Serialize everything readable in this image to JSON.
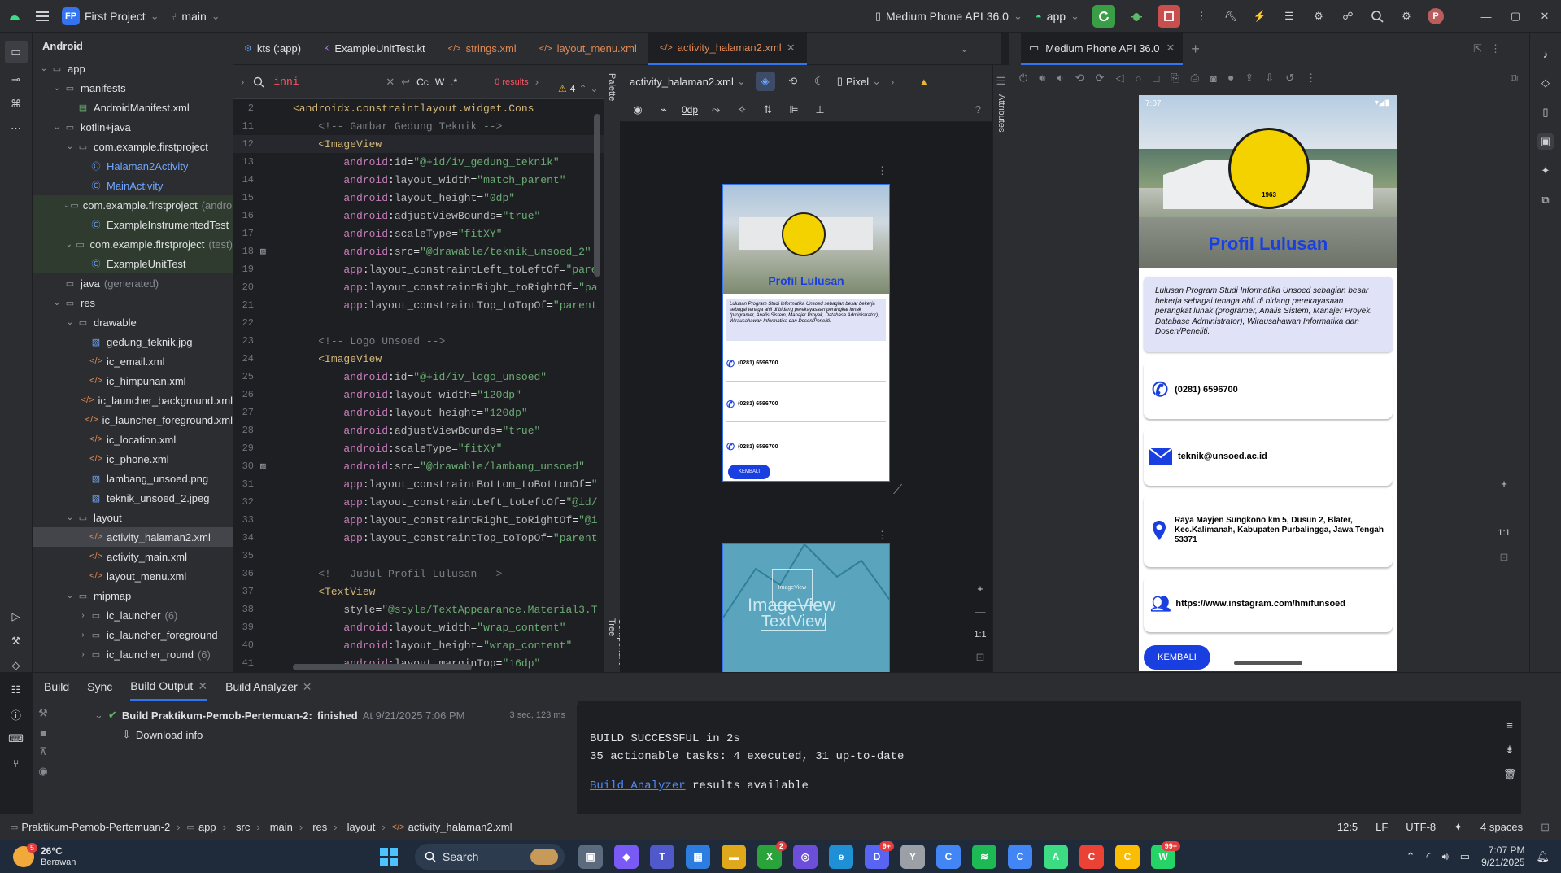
{
  "titlebar": {
    "project_chip": "FP",
    "project": "First Project",
    "branch": "main",
    "device": "Medium Phone API 36.0",
    "run_config": "app",
    "avatar": "P"
  },
  "project_panel": {
    "title": "Android",
    "tree": [
      {
        "label": "app",
        "depth": 0,
        "icon": "folder",
        "open": true
      },
      {
        "label": "manifests",
        "depth": 1,
        "icon": "folder",
        "open": true
      },
      {
        "label": "AndroidManifest.xml",
        "depth": 2,
        "icon": "manifest"
      },
      {
        "label": "kotlin+java",
        "depth": 1,
        "icon": "folder",
        "open": true
      },
      {
        "label": "com.example.firstproject",
        "depth": 2,
        "icon": "package",
        "open": true
      },
      {
        "label": "Halaman2Activity",
        "depth": 3,
        "icon": "class",
        "color": "blue"
      },
      {
        "label": "MainActivity",
        "depth": 3,
        "icon": "class",
        "color": "blue"
      },
      {
        "label": "com.example.firstproject",
        "depth": 2,
        "icon": "package",
        "open": true,
        "suffix": "(androidTest)",
        "hl": true
      },
      {
        "label": "ExampleInstrumentedTest",
        "depth": 3,
        "icon": "class",
        "hl": true
      },
      {
        "label": "com.example.firstproject",
        "depth": 2,
        "icon": "package",
        "open": true,
        "suffix": "(test)",
        "hl": true
      },
      {
        "label": "ExampleUnitTest",
        "depth": 3,
        "icon": "class",
        "hl": true
      },
      {
        "label": "java",
        "depth": 1,
        "icon": "folder",
        "suffix": "(generated)"
      },
      {
        "label": "res",
        "depth": 1,
        "icon": "folder",
        "open": true
      },
      {
        "label": "drawable",
        "depth": 2,
        "icon": "folder",
        "open": true
      },
      {
        "label": "gedung_teknik.jpg",
        "depth": 3,
        "icon": "image"
      },
      {
        "label": "ic_email.xml",
        "depth": 3,
        "icon": "xml"
      },
      {
        "label": "ic_himpunan.xml",
        "depth": 3,
        "icon": "xml"
      },
      {
        "label": "ic_launcher_background.xml",
        "depth": 3,
        "icon": "xml"
      },
      {
        "label": "ic_launcher_foreground.xml",
        "depth": 3,
        "icon": "xml"
      },
      {
        "label": "ic_location.xml",
        "depth": 3,
        "icon": "xml"
      },
      {
        "label": "ic_phone.xml",
        "depth": 3,
        "icon": "xml"
      },
      {
        "label": "lambang_unsoed.png",
        "depth": 3,
        "icon": "image"
      },
      {
        "label": "teknik_unsoed_2.jpeg",
        "depth": 3,
        "icon": "image"
      },
      {
        "label": "layout",
        "depth": 2,
        "icon": "folder",
        "open": true
      },
      {
        "label": "activity_halaman2.xml",
        "depth": 3,
        "icon": "xml",
        "selected": true
      },
      {
        "label": "activity_main.xml",
        "depth": 3,
        "icon": "xml"
      },
      {
        "label": "layout_menu.xml",
        "depth": 3,
        "icon": "xml"
      },
      {
        "label": "mipmap",
        "depth": 2,
        "icon": "folder",
        "open": true
      },
      {
        "label": "ic_launcher",
        "depth": 3,
        "icon": "folder",
        "suffix": "(6)",
        "closed": true
      },
      {
        "label": "ic_launcher_foreground",
        "depth": 3,
        "icon": "folder",
        "closed": true
      },
      {
        "label": "ic_launcher_round",
        "depth": 3,
        "icon": "folder",
        "suffix": "(6)",
        "closed": true
      }
    ]
  },
  "editor_tabs": [
    {
      "label": "kts (:app)",
      "icon": "kts"
    },
    {
      "label": "ExampleUnitTest.kt",
      "icon": "kotlin"
    },
    {
      "label": "strings.xml",
      "icon": "xml"
    },
    {
      "label": "layout_menu.xml",
      "icon": "xml"
    },
    {
      "label": "activity_halaman2.xml",
      "icon": "xml",
      "active": true
    }
  ],
  "find": {
    "query": "inni",
    "results": "0 results",
    "case": "Cc",
    "word": "W",
    "regex": ".*"
  },
  "code": {
    "warnings": "4",
    "lines": [
      {
        "n": "2",
        "html": "<span class='tag'>&lt;androidx.constraintlayout.widget.Cons</span>"
      },
      {
        "n": "11",
        "html": "    <span class='cmt'>&lt;!-- Gambar Gedung Teknik --&gt;</span>"
      },
      {
        "n": "12",
        "html": "    <span class='tag'>&lt;ImageView</span>",
        "cur": true
      },
      {
        "n": "13",
        "html": "        <span class='ns'>android</span>:<span class='attr'>id</span>=<span class='val'>\"@+id/iv_gedung_teknik\"</span>"
      },
      {
        "n": "14",
        "html": "        <span class='ns'>android</span>:<span class='attr'>layout_width</span>=<span class='val'>\"match_parent\"</span>"
      },
      {
        "n": "15",
        "html": "        <span class='ns'>android</span>:<span class='attr'>layout_height</span>=<span class='val'>\"0dp\"</span>"
      },
      {
        "n": "16",
        "html": "        <span class='ns'>android</span>:<span class='attr'>adjustViewBounds</span>=<span class='val'>\"true\"</span>"
      },
      {
        "n": "17",
        "html": "        <span class='ns'>android</span>:<span class='attr'>scaleType</span>=<span class='val'>\"fitXY\"</span>"
      },
      {
        "n": "18",
        "html": "        <span class='ns'>android</span>:<span class='attr'>src</span>=<span class='val'>\"@drawable/teknik_unsoed_2\"</span>",
        "gutter": "img"
      },
      {
        "n": "19",
        "html": "        <span class='ns'>app</span>:<span class='attr'>layout_constraintLeft_toLeftOf</span>=<span class='val'>\"pare</span>"
      },
      {
        "n": "20",
        "html": "        <span class='ns'>app</span>:<span class='attr'>layout_constraintRight_toRightOf</span>=<span class='val'>\"pa</span>"
      },
      {
        "n": "21",
        "html": "        <span class='ns'>app</span>:<span class='attr'>layout_constraintTop_toTopOf</span>=<span class='val'>\"parent</span>"
      },
      {
        "n": "22",
        "html": ""
      },
      {
        "n": "23",
        "html": "    <span class='cmt'>&lt;!-- Logo Unsoed --&gt;</span>"
      },
      {
        "n": "24",
        "html": "    <span class='tag'>&lt;ImageView</span>"
      },
      {
        "n": "25",
        "html": "        <span class='ns'>android</span>:<span class='attr'>id</span>=<span class='val'>\"@+id/iv_logo_unsoed\"</span>"
      },
      {
        "n": "26",
        "html": "        <span class='ns'>android</span>:<span class='attr'>layout_width</span>=<span class='val'>\"120dp\"</span>"
      },
      {
        "n": "27",
        "html": "        <span class='ns'>android</span>:<span class='attr'>layout_height</span>=<span class='val'>\"120dp\"</span>"
      },
      {
        "n": "28",
        "html": "        <span class='ns'>android</span>:<span class='attr'>adjustViewBounds</span>=<span class='val'>\"true\"</span>"
      },
      {
        "n": "29",
        "html": "        <span class='ns'>android</span>:<span class='attr'>scaleType</span>=<span class='val'>\"fitXY\"</span>"
      },
      {
        "n": "30",
        "html": "        <span class='ns'>android</span>:<span class='attr'>src</span>=<span class='val'>\"@drawable/lambang_unsoed\"</span>",
        "gutter": "img"
      },
      {
        "n": "31",
        "html": "        <span class='ns'>app</span>:<span class='attr'>layout_constraintBottom_toBottomOf</span>=<span class='val'>\"</span>"
      },
      {
        "n": "32",
        "html": "        <span class='ns'>app</span>:<span class='attr'>layout_constraintLeft_toLeftOf</span>=<span class='val'>\"@id/</span>"
      },
      {
        "n": "33",
        "html": "        <span class='ns'>app</span>:<span class='attr'>layout_constraintRight_toRightOf</span>=<span class='val'>\"@i</span>"
      },
      {
        "n": "34",
        "html": "        <span class='ns'>app</span>:<span class='attr'>layout_constraintTop_toTopOf</span>=<span class='val'>\"parent</span>"
      },
      {
        "n": "35",
        "html": ""
      },
      {
        "n": "36",
        "html": "    <span class='cmt'>&lt;!-- Judul Profil Lulusan --&gt;</span>"
      },
      {
        "n": "37",
        "html": "    <span class='tag'>&lt;TextView</span>"
      },
      {
        "n": "38",
        "html": "        <span class='attr'>style</span>=<span class='val'>\"@style/TextAppearance.Material3.T</span>"
      },
      {
        "n": "39",
        "html": "        <span class='ns'>android</span>:<span class='attr'>layout_width</span>=<span class='val'>\"wrap_content\"</span>"
      },
      {
        "n": "40",
        "html": "        <span class='ns'>android</span>:<span class='attr'>layout_height</span>=<span class='val'>\"wrap_content\"</span>"
      },
      {
        "n": "41",
        "html": "        <span class='ns'>android</span>:<span class='attr'>layout_marginTop</span>=<span class='val'>\"16dp\"</span>"
      }
    ]
  },
  "design": {
    "file": "activity_halaman2.xml",
    "device": "Pixel",
    "margin": "0dp",
    "palette_label": "Palette",
    "component_tree_label": "Component Tree",
    "attributes_label": "Attributes",
    "preview": {
      "title": "Profil Lulusan",
      "desc": "Lulusan Program Studi Informatika Unsoed sebagian besar bekerja sebagai tenaga ahli di bidang perekayasaan perangkat lunak (programer, Analis Sistem, Manajer Proyek, Database Administrator), Wirausahawan Informatika dan Dosen/Peneliti.",
      "phone": "(0281) 6596700",
      "button": "KEMBALI"
    },
    "blueprint_imageview": "ImageView",
    "blueprint_textview": "TextView",
    "blueprint_small": "ImageView",
    "zoom": "1:1"
  },
  "emulator": {
    "tab": "Medium Phone API 36.0",
    "status_time": "7:07",
    "title": "Profil Lulusan",
    "seal_year": "1963",
    "desc": "Lulusan Program Studi Informatika Unsoed sebagian besar bekerja sebagai tenaga ahli di bidang perekayasaan perangkat lunak (programer, Analis Sistem, Manajer Proyek. Database Administrator), Wirausahawan Informatika dan Dosen/Peneliti.",
    "phone": "(0281) 6596700",
    "email": "teknik@unsoed.ac.id",
    "address": "Raya Mayjen Sungkono km 5, Dusun 2, Blater, Kec.Kalimanah, Kabupaten Purbalingga, Jawa Tengah 53371",
    "instagram": "https://www.instagram.com/hmifunsoed",
    "button": "KEMBALI",
    "accent": "#1a3fe0"
  },
  "bottom": {
    "tabs": [
      "Build",
      "Sync",
      "Build Output",
      "Build Analyzer"
    ],
    "build_title": "Build Praktikum-Pemob-Pertemuan-2:",
    "build_status": "finished",
    "build_time": "At 9/21/2025 7:06 PM",
    "build_duration": "3 sec, 123 ms",
    "download": "Download info",
    "out_line1": "BUILD SUCCESSFUL in 2s",
    "out_line2": "35 actionable tasks: 4 executed, 31 up-to-date",
    "out_link": "Build Analyzer",
    "out_line3": " results available"
  },
  "statusbar": {
    "crumbs": [
      "Praktikum-Pemob-Pertemuan-2",
      "app",
      "src",
      "main",
      "res",
      "layout",
      "activity_halaman2.xml"
    ],
    "pos": "12:5",
    "lf": "LF",
    "enc": "UTF-8",
    "indent": "4 spaces"
  },
  "taskbar": {
    "temp": "26°C",
    "weather": "Berawan",
    "weather_badge": "5",
    "search": "Search",
    "time": "7:07 PM",
    "date": "9/21/2025",
    "apps": [
      {
        "name": "task-view",
        "color": "#5b6a7d",
        "glyph": "▣"
      },
      {
        "name": "copilot",
        "color": "#7a5af5",
        "glyph": "◆"
      },
      {
        "name": "teams",
        "color": "#5059c9",
        "glyph": "T"
      },
      {
        "name": "store",
        "color": "#2d7de0",
        "glyph": "▦"
      },
      {
        "name": "file-explorer",
        "color": "#e0a81b",
        "glyph": "▬"
      },
      {
        "name": "xbox",
        "color": "#2aa33a",
        "glyph": "X",
        "badge": "2"
      },
      {
        "name": "camera-app",
        "color": "#6b4fd8",
        "glyph": "◎"
      },
      {
        "name": "edge",
        "color": "#1f8fd6",
        "glyph": "e"
      },
      {
        "name": "discord",
        "color": "#5865f2",
        "glyph": "D",
        "badge": "9+"
      },
      {
        "name": "vpn",
        "color": "#9aa0a6",
        "glyph": "Y"
      },
      {
        "name": "chrome-profile",
        "color": "#4285f4",
        "glyph": "C"
      },
      {
        "name": "spotify",
        "color": "#1db954",
        "glyph": "≋"
      },
      {
        "name": "chrome-p",
        "color": "#4285f4",
        "glyph": "C"
      },
      {
        "name": "android-studio",
        "color": "#3ddc84",
        "glyph": "A"
      },
      {
        "name": "chrome-r",
        "color": "#ea4335",
        "glyph": "C"
      },
      {
        "name": "chrome",
        "color": "#fbbc04",
        "glyph": "C"
      },
      {
        "name": "whatsapp",
        "color": "#25d366",
        "glyph": "W",
        "badge": "99+"
      }
    ]
  }
}
